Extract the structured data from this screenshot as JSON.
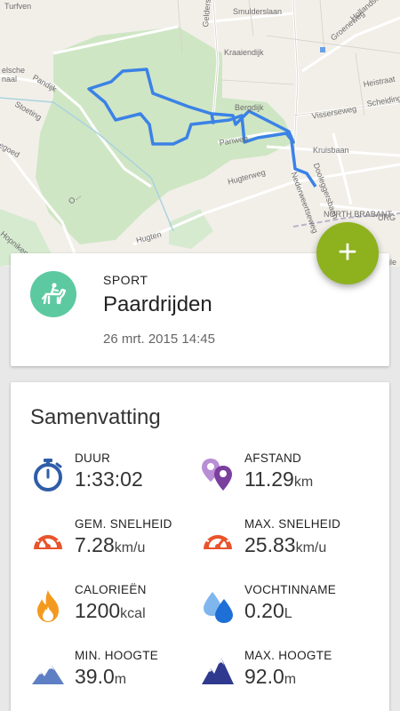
{
  "map": {
    "labels": {
      "turfven": "Turfven",
      "smulderslaan": "Smulderslaan",
      "gelderselaan": "Gelderselaan",
      "kraaiendijk": "Kraaiendijk",
      "groeneweg": "Groeneweg",
      "hollandseweg": "Hollandseweg",
      "selsche": "elsche",
      "naal": "naal",
      "pandijk": "Pandijk",
      "stoeting": "Stoeting",
      "egoed": "egoed",
      "bergdijk": "Bergdijk",
      "visserseweg": "Visserseweg",
      "scheidingsweg": "Scheidingsw",
      "heistraat": "Heistraat",
      "kruisbaan": "Kruisbaan",
      "panweg": "Panweg",
      "dooleggersbaan": "Dooleggersbaan",
      "hugterweg": "Hugterweg",
      "nederweertseweg": "Nederweertseweg",
      "ohoek": "O...",
      "north_brabant": "NORTH BRABANT",
      "limburg": "URG",
      "hopniken": "Hopniken",
      "hugten": "Hugten",
      "google": "gle"
    },
    "colors": {
      "route": "#3b82e6",
      "forest": "#cfe6c4",
      "land": "#f2efe9",
      "road": "#ffffff",
      "border": "#b9b4c7"
    }
  },
  "fab": {
    "label": "+",
    "color": "#8db21e"
  },
  "sport_card": {
    "caption": "SPORT",
    "name": "Paardrijden",
    "date": "26 mrt. 2015 14:45",
    "icon": "horse-riding-icon",
    "icon_color": "#5dc9a0"
  },
  "summary": {
    "title": "Samenvatting",
    "stats": {
      "duration": {
        "label": "DUUR",
        "value": "1:33:02",
        "unit": "",
        "icon": "stopwatch-icon"
      },
      "distance": {
        "label": "AFSTAND",
        "value": "11.29",
        "unit": "km",
        "icon": "map-pins-icon"
      },
      "avg_speed": {
        "label": "GEM. SNELHEID",
        "value": "7.28",
        "unit": "km/u",
        "icon": "speedometer-icon"
      },
      "max_speed": {
        "label": "MAX. SNELHEID",
        "value": "25.83",
        "unit": "km/u",
        "icon": "speedometer-max-icon"
      },
      "calories": {
        "label": "CALORIEËN",
        "value": "1200",
        "unit": "kcal",
        "icon": "flame-icon"
      },
      "hydration": {
        "label": "VOCHTINNAME",
        "value": "0.20",
        "unit": "L",
        "icon": "water-drops-icon"
      },
      "min_altitude": {
        "label": "MIN. HOOGTE",
        "value": "39.0",
        "unit": "m",
        "icon": "mountain-low-icon"
      },
      "max_altitude": {
        "label": "MAX. HOOGTE",
        "value": "92.0",
        "unit": "m",
        "icon": "mountain-high-icon"
      }
    }
  }
}
